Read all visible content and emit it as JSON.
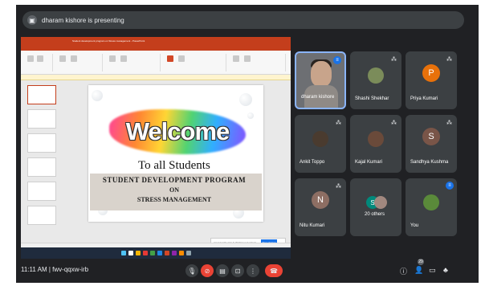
{
  "banner": {
    "text": "dharam kishore is presenting",
    "icon": "present-icon"
  },
  "shared_screen": {
    "window_title": "Student development program on Stress management - PowerPoint",
    "slide": {
      "headline": "Welcome",
      "subheadline": "To all Students",
      "line1": "STUDENT DEVELOPMENT PROGRAM",
      "line2": "ON",
      "line3": "STRESS MANAGEMENT"
    },
    "share_notice": "meet.google.com is sharing your screen.",
    "stop_label": "Stop sharing"
  },
  "participants": [
    {
      "name": "dharam kishore",
      "type": "video",
      "speaking": true
    },
    {
      "name": "Shashi Shekhar",
      "type": "photo",
      "muted": true,
      "color": "#7b8c5a"
    },
    {
      "name": "Priya Kumari",
      "type": "letter",
      "letter": "P",
      "muted": true,
      "color": "#e8710a"
    },
    {
      "name": "Ankit Toppo",
      "type": "photo",
      "muted": true,
      "color": "#4a3b2f"
    },
    {
      "name": "Kajal Kumari",
      "type": "photo",
      "muted": true,
      "color": "#6a4a3a"
    },
    {
      "name": "Sandhya Kushma",
      "type": "letter",
      "letter": "S",
      "muted": true,
      "color": "#795548"
    },
    {
      "name": "Nitu Kumari",
      "type": "letter",
      "letter": "N",
      "muted": true,
      "color": "#8d6e63"
    },
    {
      "name": "20 others",
      "type": "group"
    },
    {
      "name": "You",
      "type": "photo",
      "speaking": true,
      "color": "#5a8a3a"
    }
  ],
  "others_avatars": [
    {
      "letter": "S",
      "color": "#00897b"
    },
    {
      "letter": "",
      "color": "#a1887f"
    }
  ],
  "controls": {
    "time": "11:11 AM",
    "separator": "|",
    "meeting_code": "fwv-qqxw-irb",
    "participant_count": "29"
  },
  "colors": {
    "leave": "#ea4335",
    "mic_off": "#ea4335",
    "accent": "#1a73e8",
    "bg": "#202124"
  }
}
